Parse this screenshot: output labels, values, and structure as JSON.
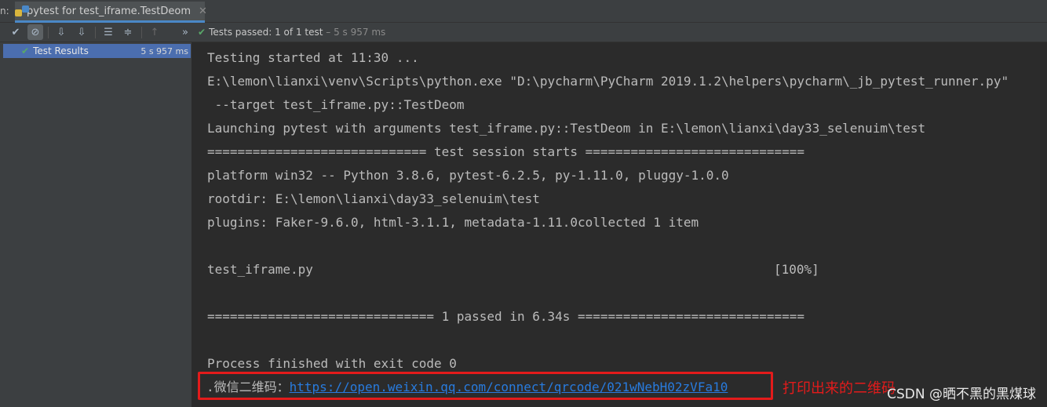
{
  "tabbar": {
    "prefix": "n:",
    "tab_label": "pytest for test_iframe.TestDeom",
    "close_glyph": "✕",
    "icon": "python-icon"
  },
  "toolbar": {
    "buttons": [
      {
        "name": "show-passed-icon",
        "glyph": "✔"
      },
      {
        "name": "show-ignored-icon",
        "glyph": "⊘"
      },
      {
        "name": "sort-alpha-icon",
        "glyph": "⇩"
      },
      {
        "name": "sort-duration-icon",
        "glyph": "⇩"
      },
      {
        "name": "expand-all-icon",
        "glyph": "☰"
      },
      {
        "name": "collapse-all-icon",
        "glyph": "≑"
      },
      {
        "name": "prev-failed-icon",
        "glyph": "↑"
      },
      {
        "name": "more-icon",
        "glyph": "»"
      }
    ],
    "status_label": "Tests passed:",
    "status_count": "1 of 1 test",
    "status_time": "– 5 s 957 ms"
  },
  "tree": {
    "root_label": "Test Results",
    "root_time": "5 s 957 ms"
  },
  "console": {
    "lines": [
      "Testing started at 11:30 ...",
      "E:\\lemon\\lianxi\\venv\\Scripts\\python.exe \"D:\\pycharm\\PyCharm 2019.1.2\\helpers\\pycharm\\_jb_pytest_runner.py\"",
      " --target test_iframe.py::TestDeom",
      "Launching pytest with arguments test_iframe.py::TestDeom in E:\\lemon\\lianxi\\day33_selenuim\\test",
      "============================= test session starts =============================",
      "platform win32 -- Python 3.8.6, pytest-6.2.5, py-1.11.0, pluggy-1.0.0",
      "rootdir: E:\\lemon\\lianxi\\day33_selenuim\\test",
      "plugins: Faker-9.6.0, html-3.1.1, metadata-1.11.0collected 1 item",
      "test_iframe.py",
      "[100%]",
      "============================== 1 passed in 6.34s ==============================",
      "Process finished with exit code 0"
    ],
    "wx_prefix": ".微信二维码：",
    "wx_link": "https://open.weixin.qq.com/connect/qrcode/021wNebH02zVFa10",
    "annotation": "打印出来的二维码",
    "watermark": "CSDN @晒不黑的黑煤球"
  },
  "colors": {
    "pass_green": "#59a869",
    "selection_blue": "#4b6eaf",
    "link_blue": "#287bde",
    "highlight_red": "#e31b1b"
  }
}
